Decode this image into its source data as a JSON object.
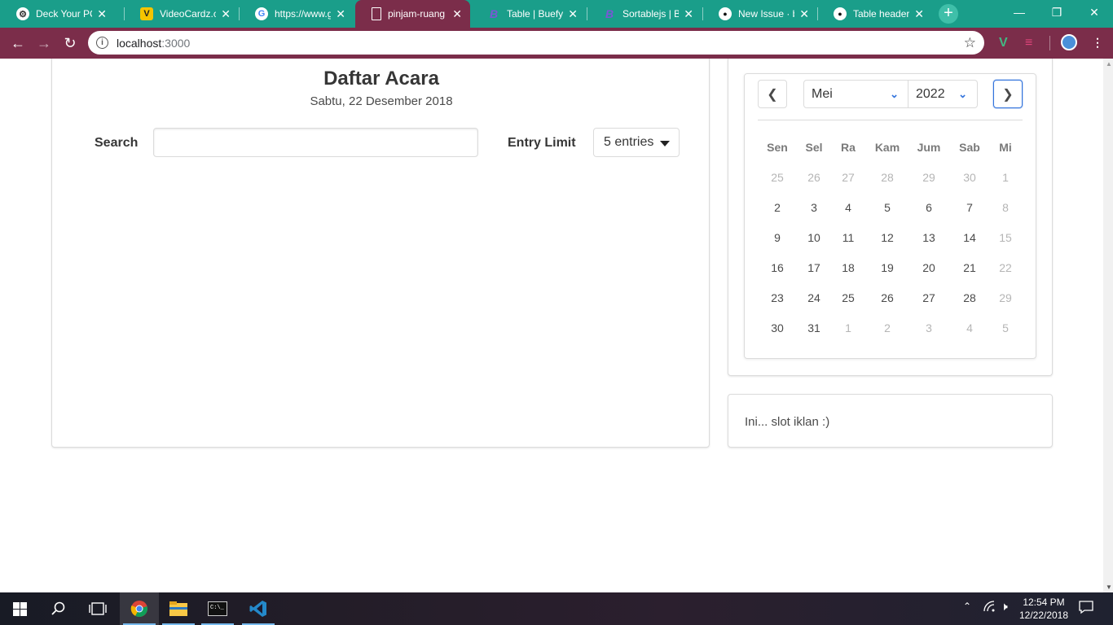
{
  "browser": {
    "tabs": [
      {
        "title": "Deck Your PC W",
        "icon": "deck-icon",
        "color": "#444444"
      },
      {
        "title": "VideoCardz.co",
        "icon": "videocardz-icon",
        "color": "#f5c400"
      },
      {
        "title": "https://www.g",
        "icon": "google-icon",
        "color": "#ffffff"
      },
      {
        "title": "pinjam-ruang",
        "icon": "page-icon",
        "color": "#ffffff"
      },
      {
        "title": "Table | Buefy",
        "icon": "buefy-icon",
        "color": "#7957d5"
      },
      {
        "title": "Sortablejs | Bu",
        "icon": "buefy-icon",
        "color": "#7957d5"
      },
      {
        "title": "New Issue · bu",
        "icon": "github-icon",
        "color": "#ffffff"
      },
      {
        "title": "Table header d",
        "icon": "github-icon",
        "color": "#ffffff"
      }
    ],
    "url_host": "localhost",
    "url_port": ":3000"
  },
  "page": {
    "title": "Daftar Acara",
    "subtitle": "Sabtu, 22 Desember 2018",
    "search_label": "Search",
    "search_value": "",
    "entry_label": "Entry Limit",
    "entry_value": "5 entries"
  },
  "calendar": {
    "month": "Mei",
    "year": "2022",
    "weekdays": [
      "Sen",
      "Sel",
      "Ra",
      "Kam",
      "Jum",
      "Sab",
      "Mi"
    ],
    "weeks": [
      [
        {
          "d": "25",
          "muted": true
        },
        {
          "d": "26",
          "muted": true
        },
        {
          "d": "27",
          "muted": true
        },
        {
          "d": "28",
          "muted": true
        },
        {
          "d": "29",
          "muted": true
        },
        {
          "d": "30",
          "muted": true
        },
        {
          "d": "1",
          "muted": true
        }
      ],
      [
        {
          "d": "2"
        },
        {
          "d": "3"
        },
        {
          "d": "4"
        },
        {
          "d": "5"
        },
        {
          "d": "6"
        },
        {
          "d": "7"
        },
        {
          "d": "8",
          "muted": true
        }
      ],
      [
        {
          "d": "9"
        },
        {
          "d": "10"
        },
        {
          "d": "11"
        },
        {
          "d": "12"
        },
        {
          "d": "13"
        },
        {
          "d": "14"
        },
        {
          "d": "15",
          "muted": true
        }
      ],
      [
        {
          "d": "16"
        },
        {
          "d": "17"
        },
        {
          "d": "18"
        },
        {
          "d": "19"
        },
        {
          "d": "20"
        },
        {
          "d": "21"
        },
        {
          "d": "22",
          "muted": true
        }
      ],
      [
        {
          "d": "23"
        },
        {
          "d": "24"
        },
        {
          "d": "25"
        },
        {
          "d": "26"
        },
        {
          "d": "27"
        },
        {
          "d": "28"
        },
        {
          "d": "29",
          "muted": true
        }
      ],
      [
        {
          "d": "30"
        },
        {
          "d": "31"
        },
        {
          "d": "1",
          "muted": true
        },
        {
          "d": "2",
          "muted": true
        },
        {
          "d": "3",
          "muted": true
        },
        {
          "d": "4",
          "muted": true
        },
        {
          "d": "5",
          "muted": true
        }
      ]
    ]
  },
  "ad": {
    "text": "Ini... slot iklan :)"
  },
  "taskbar": {
    "time": "12:54 PM",
    "date": "12/22/2018"
  },
  "colors": {
    "tabstrip": "#1a9e8a",
    "toolbar": "#7b2d4a",
    "accent": "#3273dc"
  }
}
